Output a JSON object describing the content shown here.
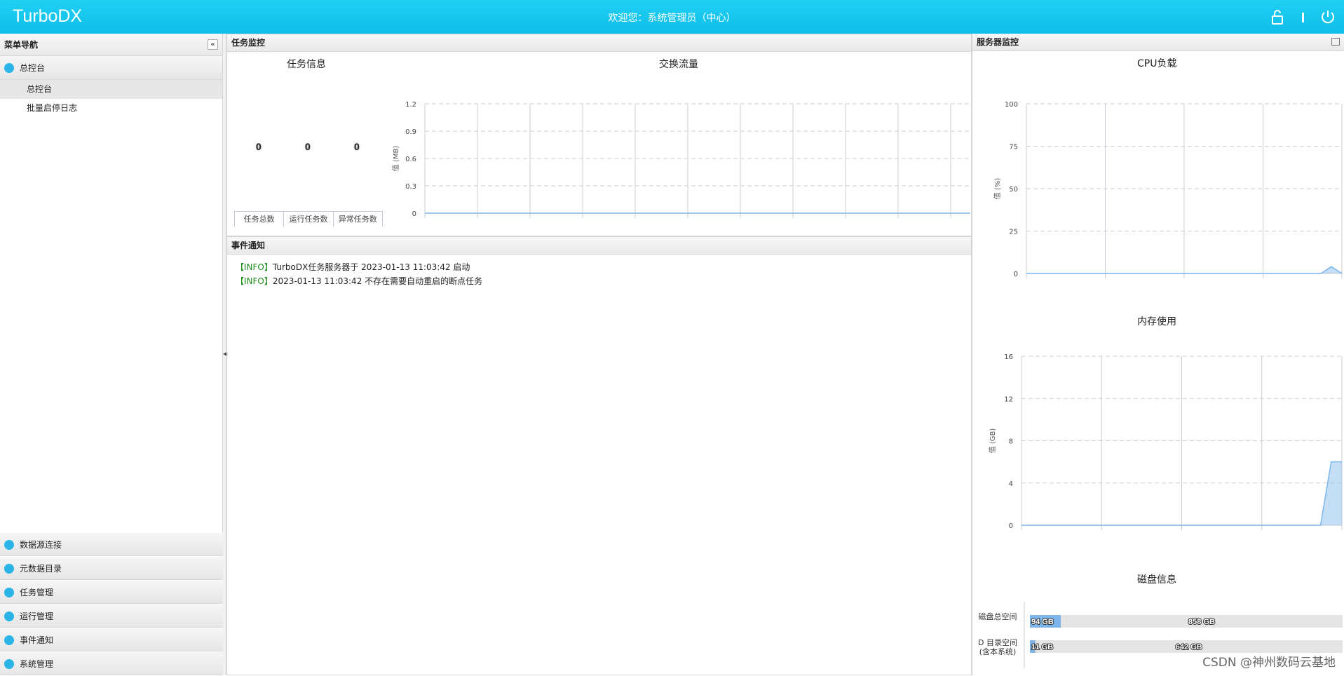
{
  "header": {
    "brand": "TurboDX",
    "welcome": "欢迎您：系统管理员（中心）"
  },
  "sidebar": {
    "title": "菜单导航",
    "collapse_glyph": "«",
    "top_group": {
      "label": "总控台",
      "icon": "monitor-icon"
    },
    "sub_items": [
      {
        "label": "总控台",
        "active": true
      },
      {
        "label": "批量启停日志",
        "active": false
      }
    ],
    "bottom_groups": [
      {
        "label": "数据源连接",
        "icon": "link-icon"
      },
      {
        "label": "元数据目录",
        "icon": "catalog-icon"
      },
      {
        "label": "任务管理",
        "icon": "clock-icon"
      },
      {
        "label": "运行管理",
        "icon": "cluster-icon"
      },
      {
        "label": "事件通知",
        "icon": "message-icon"
      },
      {
        "label": "系统管理",
        "icon": "gear-icon"
      }
    ]
  },
  "task_panel": {
    "title": "任务监控",
    "info_title": "任务信息",
    "counters": [
      {
        "label": "任务总数",
        "value": "0"
      },
      {
        "label": "运行任务数",
        "value": "0"
      },
      {
        "label": "异常任务数",
        "value": "0"
      }
    ]
  },
  "event_panel": {
    "title": "事件通知",
    "events": [
      {
        "tag": "【INFO】",
        "text": "TurboDX任务服务器于 2023-01-13 11:03:42 启动"
      },
      {
        "tag": "【INFO】",
        "text": "2023-01-13 11:03:42 不存在需要自动重启的断点任务"
      }
    ]
  },
  "server_panel": {
    "title": "服务器监控"
  },
  "chart_data": [
    {
      "id": "exchange",
      "type": "line",
      "title": "交换流量",
      "ylabel": "值 (MB)",
      "ylim": [
        0,
        1.2
      ],
      "yticks": [
        "0",
        "0.3",
        "0.6",
        "0.9",
        "1.2"
      ],
      "series": [
        {
          "values": [
            0,
            0,
            0,
            0,
            0,
            0,
            0,
            0,
            0,
            0,
            0
          ]
        }
      ],
      "grid": true
    },
    {
      "id": "cpu",
      "type": "area",
      "title": "CPU负载",
      "ylabel": "值 (%)",
      "ylim": [
        0,
        100
      ],
      "yticks": [
        "0",
        "25",
        "50",
        "75",
        "100"
      ],
      "series": [
        {
          "values": [
            0,
            0,
            0,
            0,
            0,
            0,
            0,
            0,
            0,
            0,
            0,
            0,
            0,
            0,
            0,
            0,
            0,
            0,
            0,
            0,
            0,
            0,
            0,
            0,
            0,
            0,
            0,
            0,
            0,
            4,
            0
          ]
        }
      ],
      "grid": true
    },
    {
      "id": "memory",
      "type": "area",
      "title": "内存使用",
      "ylabel": "值 (GB)",
      "ylim": [
        0,
        16
      ],
      "yticks": [
        "0",
        "4",
        "8",
        "12",
        "16"
      ],
      "series": [
        {
          "values": [
            0,
            0,
            0,
            0,
            0,
            0,
            0,
            0,
            0,
            0,
            0,
            0,
            0,
            0,
            0,
            0,
            0,
            0,
            0,
            0,
            0,
            0,
            0,
            0,
            0,
            0,
            0,
            0,
            0,
            6,
            6
          ]
        }
      ],
      "grid": true
    },
    {
      "id": "disk",
      "type": "bar",
      "title": "磁盘信息",
      "categories": [
        "磁盘总空间",
        "D 目录空间\n(含本系统)"
      ],
      "series": [
        {
          "name": "used",
          "values": [
            94,
            11
          ],
          "labels": [
            "94 GB",
            "11 GB"
          ],
          "color": "#7cb5ec"
        },
        {
          "name": "free",
          "values": [
            858,
            642
          ],
          "labels": [
            "858 GB",
            "642 GB"
          ],
          "color": "#e4e4e4"
        }
      ]
    }
  ],
  "watermark": "CSDN @神州数码云基地"
}
